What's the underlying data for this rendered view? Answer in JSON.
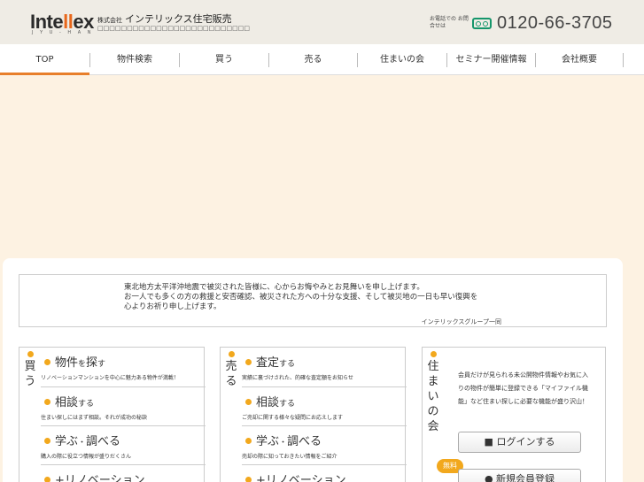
{
  "header": {
    "logo_text_1": "Inte",
    "logo_text_2": "ll",
    "logo_text_3": "ex",
    "logo_sub": "J Y U - H A N",
    "company_prefix": "株式会社",
    "company_name": "インテリックス住宅販売",
    "company_sub": "□□□□□□□□□□□□□□□□□□□□□□□□□□",
    "tel_label": "お電話での お問合せは",
    "tel_number": "0120-66-3705"
  },
  "nav": {
    "items": [
      "TOP",
      "物件検索",
      "買う",
      "売る",
      "住まいの会",
      "セミナー開催情報",
      "会社概要"
    ]
  },
  "message": {
    "line1": "東北地方太平洋沖地震で被災された皆様に、心からお悔やみとお見舞いを申し上げます。",
    "line2": "お一人でも多くの方の救援と安否確認、被災された方への十分な支援、そして被災地の一日も早い復興を",
    "line3": "心よりお祈り申し上げます。",
    "sign": "インテリックスグループ一同"
  },
  "buy": {
    "heading": [
      "買",
      "う"
    ],
    "items": [
      {
        "title": "物件",
        "title_small": "を",
        "title2": "探",
        "title2_small": "す",
        "desc": "リノベーションマンションを中心に魅力ある物件が満載！"
      },
      {
        "title": "相談",
        "title_small": "する",
        "desc": "住まい探しにはまず相談。それが成功の秘訣"
      },
      {
        "title": "学ぶ",
        "title_small": "・",
        "title2": "調べる",
        "desc": "購入の際に役立つ情報が盛りだくさん"
      },
      {
        "title": "+リノベーション",
        "desc": ""
      }
    ]
  },
  "sell": {
    "heading": [
      "売",
      "る"
    ],
    "items": [
      {
        "title": "査定",
        "title_small": "する",
        "desc": "実績に裏づけされた、的確な査定額をお知らせ"
      },
      {
        "title": "相談",
        "title_small": "する",
        "desc": "ご売却に関する様々な疑問にお応えします"
      },
      {
        "title": "学ぶ",
        "title_small": "・",
        "title2": "調べる",
        "desc": "売却の際に知っておきたい情報をご紹介"
      },
      {
        "title": "+リノベーション",
        "desc": ""
      }
    ]
  },
  "member": {
    "heading": [
      "住",
      "ま",
      "い",
      "の",
      "会"
    ],
    "text": "会員だけが見られる未公開物件情報やお気に入りの物件が簡単に登録できる「マイファイル機能」など住まい探しに必要な機能が盛り沢山！",
    "login_label": "ログインする",
    "free_badge": "無料",
    "register_label": "新規会員登録"
  },
  "colors": {
    "accent": "#e87f2b",
    "bullet": "#f2a81d",
    "tel_icon": "#15966b",
    "page_bg": "#fdf2e2"
  }
}
